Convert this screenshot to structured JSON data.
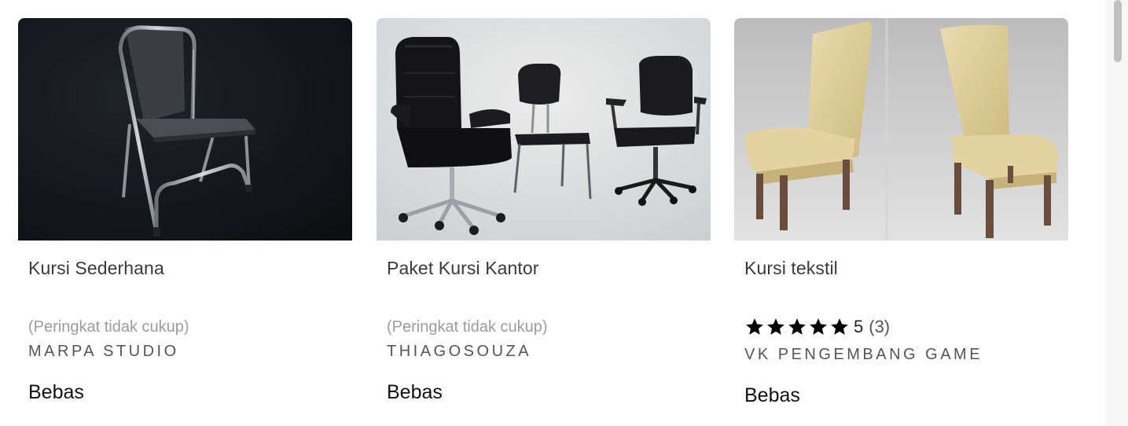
{
  "cards": [
    {
      "title": "Kursi Sederhana",
      "rating_note": "(Peringkat tidak cukup)",
      "creator": "MARPA STUDIO",
      "price": "Bebas",
      "image_icon": "folding-chair-image"
    },
    {
      "title": "Paket Kursi Kantor",
      "rating_note": "(Peringkat tidak cukup)",
      "creator": "THIAGOSOUZA",
      "price": "Bebas",
      "image_icon": "office-chairs-image"
    },
    {
      "title": "Kursi tekstil",
      "rating_value": "5",
      "rating_count": "(3)",
      "stars": 5,
      "creator": "VK PENGEMBANG GAME",
      "price": "Bebas",
      "image_icon": "textile-chairs-image"
    }
  ],
  "colors": {
    "title": "#3a3a3a",
    "muted": "#9c9c9c",
    "creator": "#555555",
    "price": "#111111"
  }
}
